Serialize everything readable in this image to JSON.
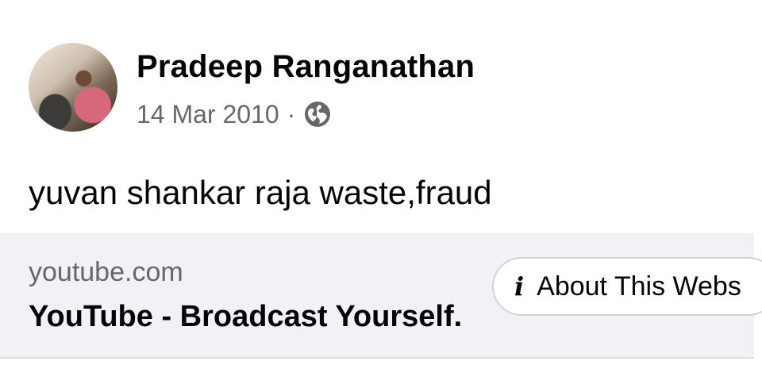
{
  "post": {
    "author": "Pradeep Ranganathan",
    "date": "14 Mar 2010",
    "separator": "·",
    "audience_icon": "globe-icon",
    "text": "yuvan shankar raja waste,fraud"
  },
  "link_preview": {
    "domain": "youtube.com",
    "title": "YouTube - Broadcast Yourself."
  },
  "about_button": {
    "icon": "info-icon",
    "icon_glyph": "i",
    "label": "About This Webs"
  },
  "colors": {
    "primary_text": "#050505",
    "secondary_text": "#65676b",
    "card_background": "#f0f2f5"
  }
}
